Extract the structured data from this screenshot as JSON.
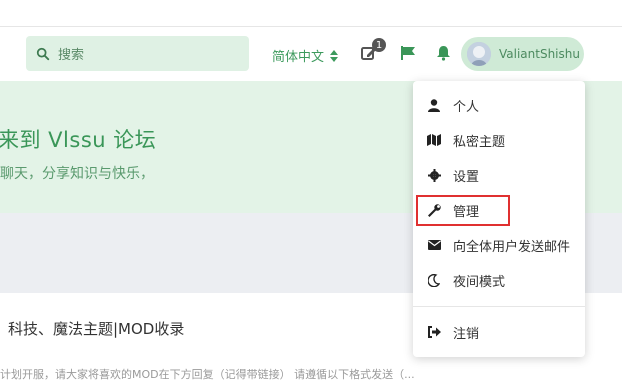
{
  "header": {
    "search_placeholder": "搜索",
    "language": "简体中文",
    "notification_badge": "1",
    "username": "ValiantShishu"
  },
  "hero": {
    "title": "来到 Vlssu 论坛",
    "subtitle": "聊天，分享知识与快乐，"
  },
  "card": {
    "title": "科技、魔法主题|MOD收录",
    "excerpt": "计划开服，请大家将喜欢的MOD在下方回复（记得带链接） 请遵循以下格式发送（..."
  },
  "user_menu": {
    "items": [
      {
        "label": "个人",
        "icon": "user-icon"
      },
      {
        "label": "私密主题",
        "icon": "map-icon"
      },
      {
        "label": "设置",
        "icon": "gear-icon"
      },
      {
        "label": "管理",
        "icon": "wrench-icon"
      },
      {
        "label": "向全体用户发送邮件",
        "icon": "envelope-icon"
      },
      {
        "label": "夜间模式",
        "icon": "moon-icon"
      },
      {
        "label": "注销",
        "icon": "sign-out-icon"
      }
    ]
  },
  "colors": {
    "accent": "#3a9658",
    "hero_bg": "#e3f3e7",
    "highlight_border": "#e03030"
  }
}
